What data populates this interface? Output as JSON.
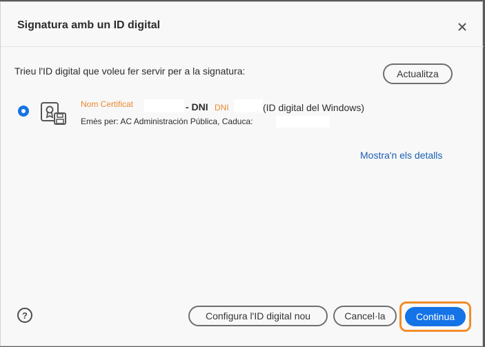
{
  "dialog": {
    "title": "Signatura amb un ID digital",
    "close_icon": "close-icon"
  },
  "prompt": "Trieu l'ID digital que voleu fer servir per a la signatura:",
  "refresh_label": "Actualitza",
  "certificate": {
    "selected": true,
    "icon": "certificate-icon",
    "name_annotation": "Nom Certificat",
    "dni_label": "- DNI",
    "dni_annotation": "DNI",
    "type": "(ID digital del Windows)",
    "issuer_line": "Emès per: AC Administración Pública, Caduca:"
  },
  "details_link": "Mostra'n els detalls",
  "footer": {
    "help_label": "?",
    "configure_label": "Configura l'ID digital nou",
    "cancel_label": "Cancel·la",
    "continue_label": "Continua"
  },
  "colors": {
    "accent": "#1473e6",
    "highlight": "#f28c28",
    "annotation": "#e8892d",
    "link": "#1a5fb4"
  }
}
